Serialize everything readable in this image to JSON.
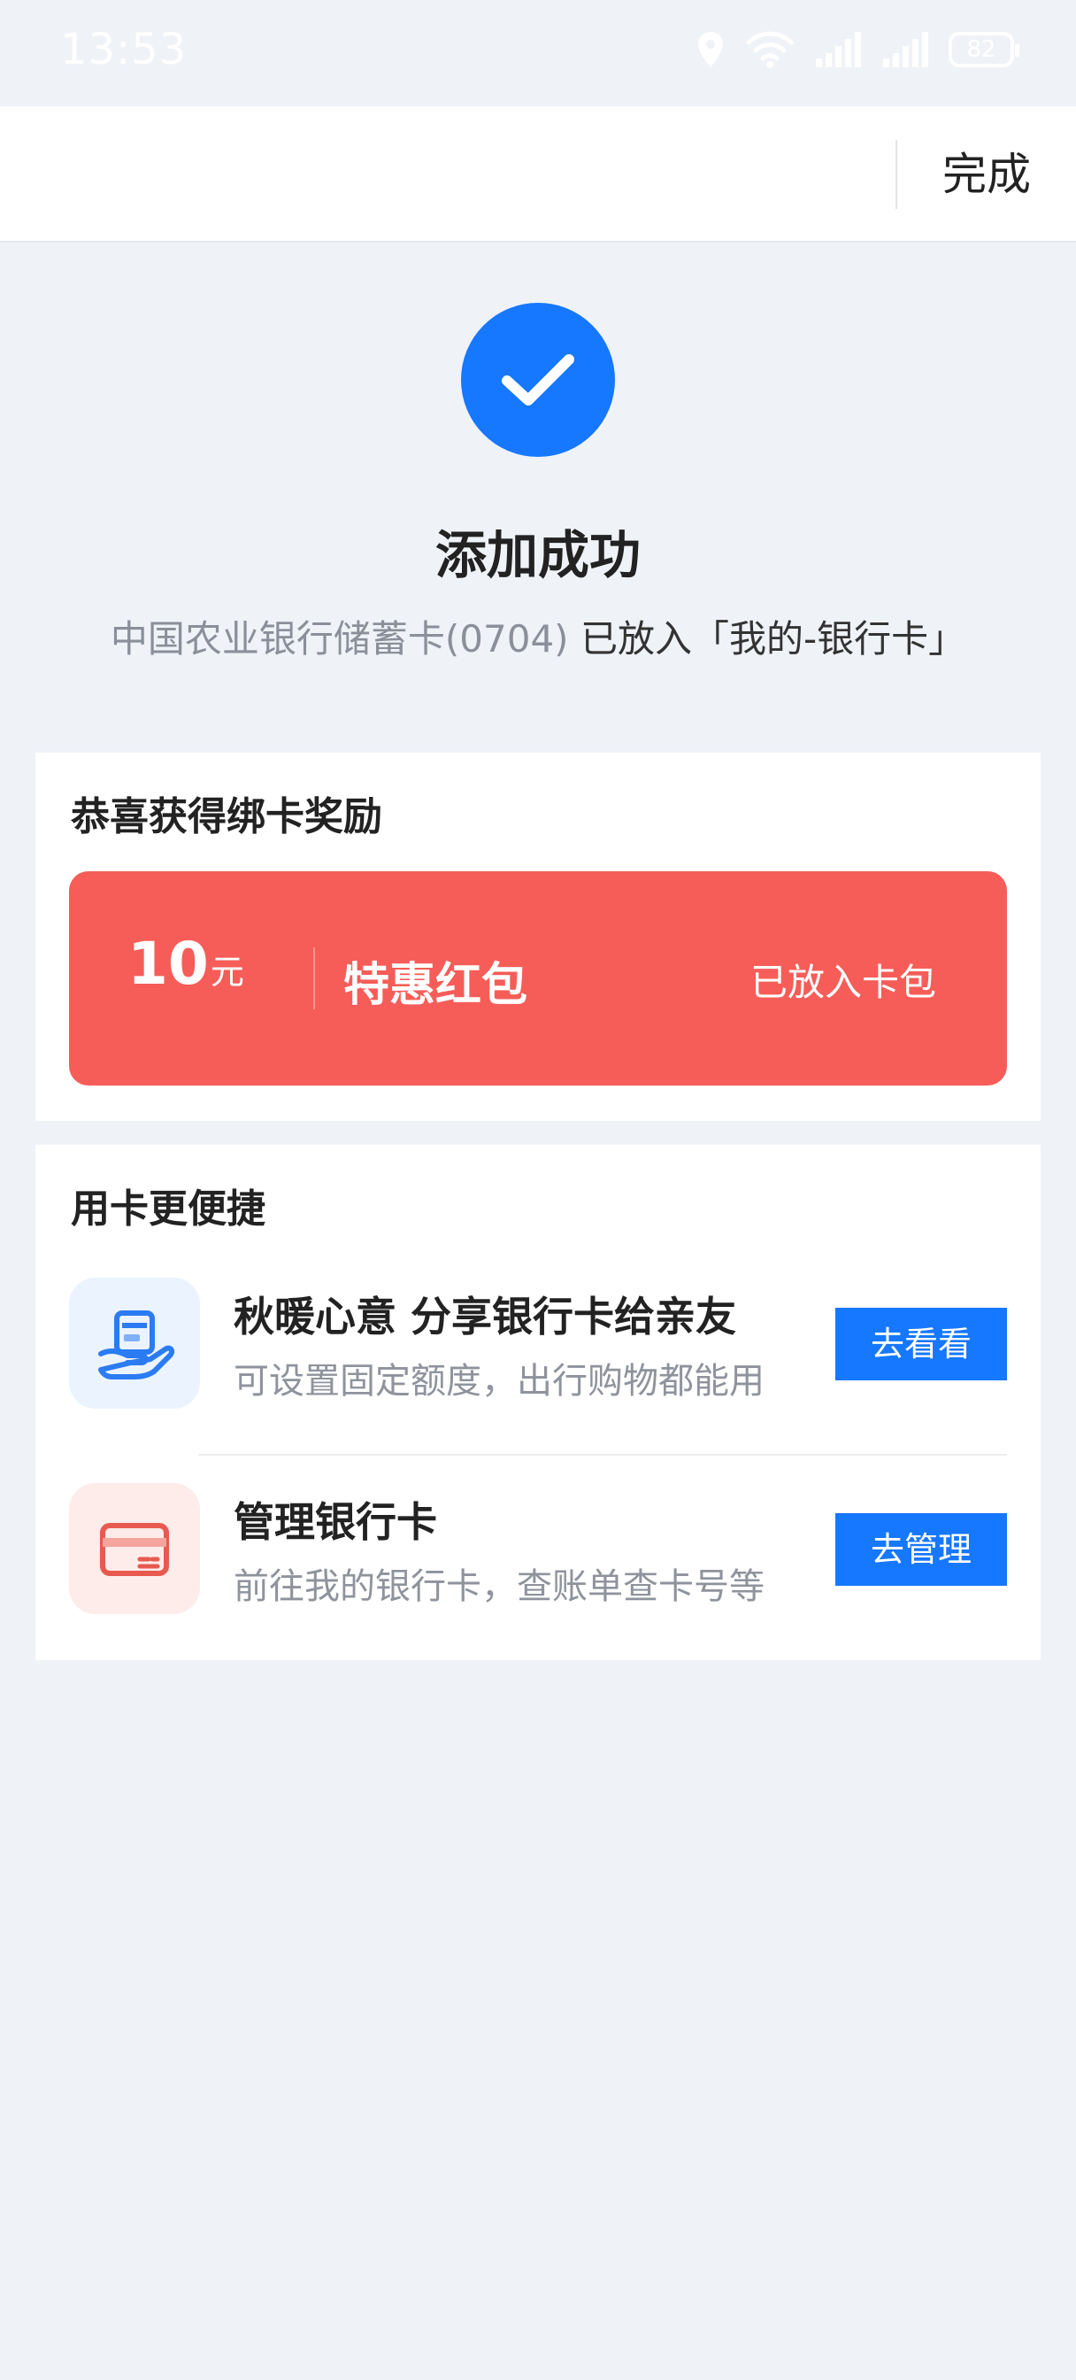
{
  "status_bar": {
    "time": "13:53",
    "battery": "82",
    "icons": [
      "location-icon",
      "wifi-icon",
      "signal-icon",
      "signal-icon",
      "battery-icon"
    ]
  },
  "nav": {
    "done_label": "完成"
  },
  "success": {
    "icon": "checkmark-icon",
    "title": "添加成功",
    "card_name": "中国农业银行储蓄卡(0704)",
    "suffix": "已放入「我的-银行卡」"
  },
  "reward": {
    "title": "恭喜获得绑卡奖励",
    "coupon": {
      "amount": "10",
      "unit": "元",
      "name": "特惠红包",
      "status": "已放入卡包"
    }
  },
  "convenience": {
    "title": "用卡更便捷",
    "items": [
      {
        "icon": "card-share-hand-icon",
        "title": "秋暖心意 分享银行卡给亲友",
        "desc": "可设置固定额度，出行购物都能用",
        "button": "去看看"
      },
      {
        "icon": "bank-card-icon",
        "title": "管理银行卡",
        "desc": "前往我的银行卡，查账单查卡号等",
        "button": "去管理"
      }
    ]
  },
  "colors": {
    "accent": "#1677ff",
    "coupon": "#f65d58",
    "background": "#eff2f7"
  }
}
